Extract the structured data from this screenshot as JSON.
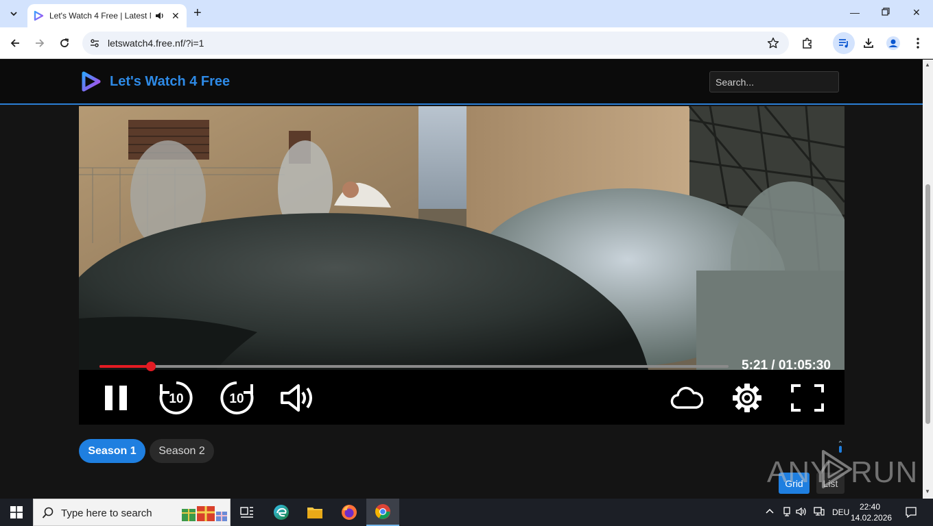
{
  "browser": {
    "tab_title": "Let's Watch 4 Free | Latest M",
    "url": "letswatch4.free.nf/?i=1"
  },
  "site": {
    "title": "Let's Watch 4 Free",
    "search_placeholder": "Search..."
  },
  "player": {
    "time_display": "5:21 / 01:05:30",
    "progress_fraction": 0.0817,
    "skip_back_label": "10",
    "skip_forward_label": "10"
  },
  "seasons": [
    {
      "label": "Season 1",
      "active": true
    },
    {
      "label": "Season 2",
      "active": false
    }
  ],
  "view_toggle": {
    "grid_label": "Grid",
    "list_label": "List"
  },
  "watermark": {
    "text_left": "ANY",
    "text_right": "RUN"
  },
  "taskbar": {
    "search_placeholder": "Type here to search",
    "language": "DEU",
    "time": "22:40",
    "date": "14.02.2026"
  },
  "colors": {
    "accent_blue": "#1f7fe0",
    "progress_red": "#e31b23",
    "header_bg": "#0b0b0b"
  }
}
